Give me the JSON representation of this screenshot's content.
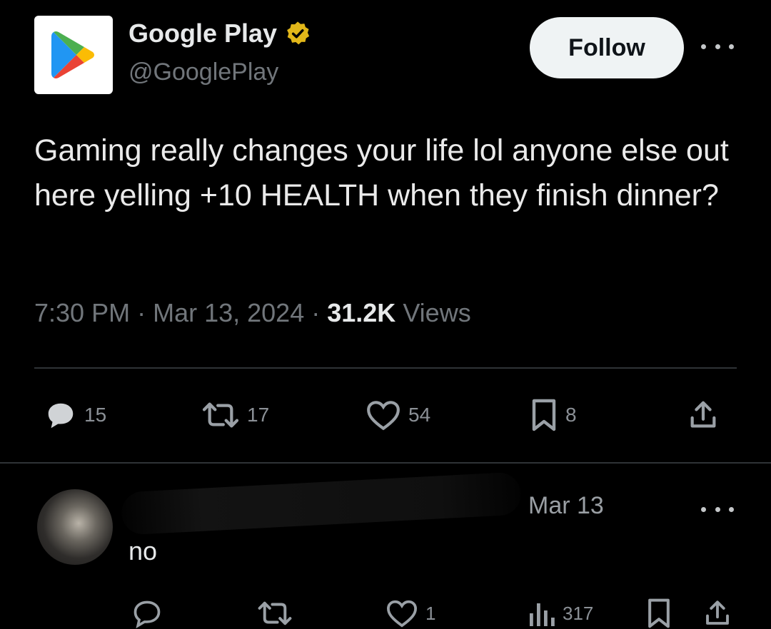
{
  "tweet": {
    "display_name": "Google Play",
    "handle": "@GooglePlay",
    "verified": true,
    "follow_label": "Follow",
    "text": "Gaming really changes your life lol anyone else out here yelling +10 HEALTH when they finish dinner?",
    "time": "7:30 PM",
    "date": "Mar 13, 2024",
    "views_count": "31.2K",
    "views_label": "Views",
    "separator": " · "
  },
  "actions": {
    "replies": "15",
    "reposts": "17",
    "likes": "54",
    "bookmarks": "8"
  },
  "reply": {
    "date": "Mar 13",
    "text": "no",
    "likes": "1",
    "views": "317"
  },
  "colors": {
    "background": "#000000",
    "text": "#e7e9ea",
    "muted": "#71767b",
    "verified_badge": "#e2b719"
  },
  "icons": {
    "logo": "google-play-logo",
    "verified": "verified-badge-icon",
    "reply": "reply-icon",
    "repost": "repost-icon",
    "like": "heart-icon",
    "bookmark": "bookmark-icon",
    "share": "share-icon",
    "views": "views-icon",
    "more": "more-icon"
  }
}
